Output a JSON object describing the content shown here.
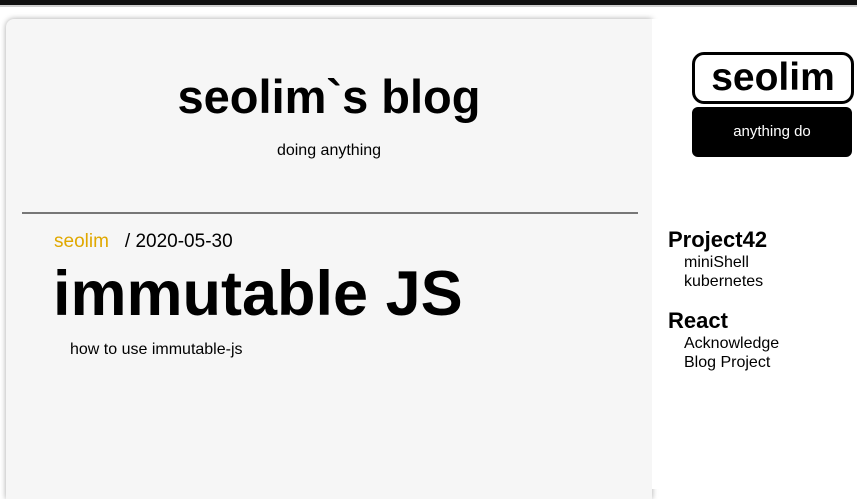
{
  "blog": {
    "title": "seolim`s blog",
    "subtitle": "doing anything"
  },
  "post": {
    "author": "seolim",
    "date": "/ 2020-05-30",
    "title": "immutable JS",
    "description": "how to use immutable-js"
  },
  "sidebar": {
    "profile_name": "seolim",
    "profile_button": "anything do",
    "categories": [
      {
        "title": "Project42",
        "items": [
          "miniShell",
          "kubernetes"
        ]
      },
      {
        "title": "React",
        "items": [
          "Acknowledge",
          "Blog Project"
        ]
      }
    ]
  },
  "colors": {
    "author_accent": "#e0a800",
    "card_background": "#f6f6f6",
    "button_background": "#000000"
  }
}
